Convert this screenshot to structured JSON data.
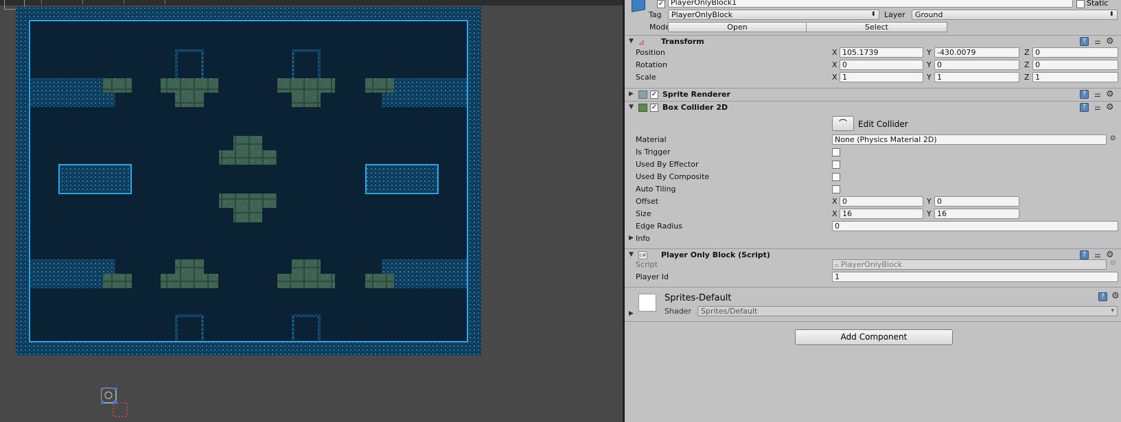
{
  "header": {
    "object_name": "PlayerOnlyBlock1",
    "static_label": "Static",
    "tag_label": "Tag",
    "tag_value": "PlayerOnlyBlock",
    "layer_label": "Layer",
    "layer_value": "Ground",
    "model_label": "Model",
    "open_label": "Open",
    "select_label": "Select"
  },
  "transform": {
    "title": "Transform",
    "position_label": "Position",
    "rotation_label": "Rotation",
    "scale_label": "Scale",
    "x": "X",
    "y": "Y",
    "z": "Z",
    "position": {
      "x": "105.1739",
      "y": "-430.0079",
      "z": "0"
    },
    "rotation": {
      "x": "0",
      "y": "0",
      "z": "0"
    },
    "scale": {
      "x": "1",
      "y": "1",
      "z": "1"
    }
  },
  "sprite_renderer": {
    "title": "Sprite Renderer"
  },
  "box_collider": {
    "title": "Box Collider 2D",
    "edit_collider_label": "Edit Collider",
    "material_label": "Material",
    "material_value": "None (Physics Material 2D)",
    "is_trigger_label": "Is Trigger",
    "used_by_effector_label": "Used By Effector",
    "used_by_composite_label": "Used By Composite",
    "auto_tiling_label": "Auto Tiling",
    "offset_label": "Offset",
    "offset": {
      "x": "0",
      "y": "0"
    },
    "size_label": "Size",
    "size": {
      "x": "16",
      "y": "16"
    },
    "edge_radius_label": "Edge Radius",
    "edge_radius_value": "0",
    "info_label": "Info"
  },
  "script_component": {
    "title": "Player Only Block (Script)",
    "script_label": "Script",
    "script_value": "PlayerOnlyBlock",
    "player_id_label": "Player Id",
    "player_id_value": "1"
  },
  "material": {
    "name": "Sprites-Default",
    "shader_label": "Shader",
    "shader_value": "Sprites/Default"
  },
  "add_component_label": "Add Component",
  "colors": {
    "inspector_bg": "#c2c2c2",
    "scene_bg": "#484848",
    "level_bg": "#0a2233",
    "wall_edge": "#1e7fc0",
    "block_fill": "#3f6352"
  }
}
